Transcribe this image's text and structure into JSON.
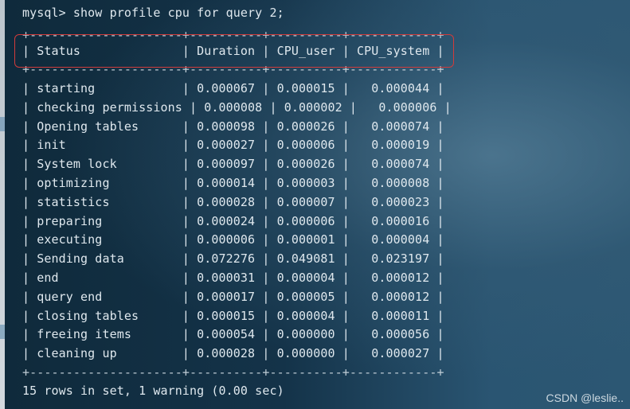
{
  "terminal": {
    "command_line": "mysql> show profile cpu for query 2;",
    "border": "+---------------------+----------+----------+------------+",
    "header_line": "| Status              | Duration | CPU_user | CPU_system |",
    "rows": [
      "| starting            | 0.000067 | 0.000015 |   0.000044 |",
      "| checking permissions | 0.000008 | 0.000002 |   0.000006 |",
      "| Opening tables      | 0.000098 | 0.000026 |   0.000074 |",
      "| init                | 0.000027 | 0.000006 |   0.000019 |",
      "| System lock         | 0.000097 | 0.000026 |   0.000074 |",
      "| optimizing          | 0.000014 | 0.000003 |   0.000008 |",
      "| statistics          | 0.000028 | 0.000007 |   0.000023 |",
      "| preparing           | 0.000024 | 0.000006 |   0.000016 |",
      "| executing           | 0.000006 | 0.000001 |   0.000004 |",
      "| Sending data        | 0.072276 | 0.049081 |   0.023197 |",
      "| end                 | 0.000031 | 0.000004 |   0.000012 |",
      "| query end           | 0.000017 | 0.000005 |   0.000012 |",
      "| closing tables      | 0.000015 | 0.000004 |   0.000011 |",
      "| freeing items       | 0.000054 | 0.000000 |   0.000056 |",
      "| cleaning up         | 0.000028 | 0.000000 |   0.000027 |"
    ],
    "footer_line": "15 rows in set, 1 warning (0.00 sec)"
  },
  "watermark": {
    "text": "CSDN @leslie.."
  },
  "colors": {
    "highlight_border": "#d13b3b",
    "terminal_text": "#dfe8ee"
  }
}
